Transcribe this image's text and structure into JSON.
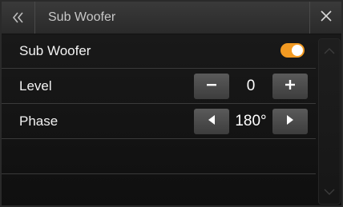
{
  "header": {
    "title": "Sub Woofer",
    "back_icon": "double-chevron-left-icon",
    "close_icon": "close-icon"
  },
  "settings": {
    "subwoofer": {
      "label": "Sub Woofer",
      "enabled": true
    },
    "level": {
      "label": "Level",
      "value": "0",
      "decrease_icon": "minus-icon",
      "increase_icon": "plus-icon"
    },
    "phase": {
      "label": "Phase",
      "value": "180°",
      "decrease_icon": "triangle-left-icon",
      "increase_icon": "triangle-right-icon"
    }
  },
  "scrollbar": {
    "up_icon": "chevron-up-icon",
    "down_icon": "chevron-down-icon"
  },
  "colors": {
    "accent": "#f29a22",
    "background": "#161616",
    "titlebar": "#333333",
    "text": "#f2f2f2",
    "button": "#4a4a4a"
  }
}
